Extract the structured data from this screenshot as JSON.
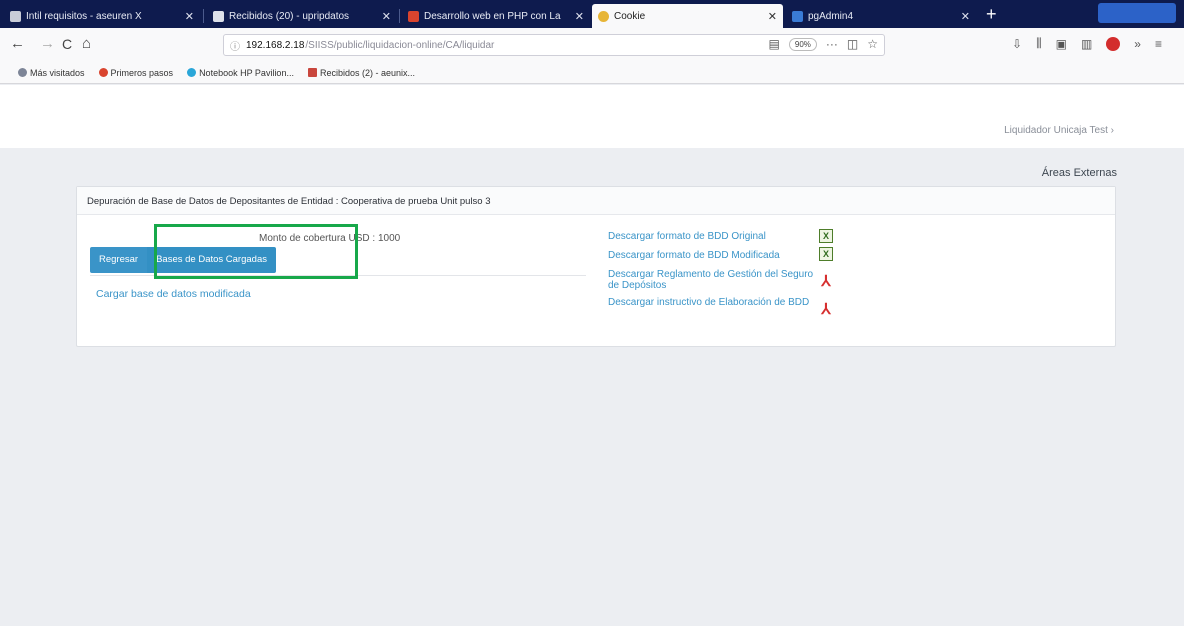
{
  "browser": {
    "tabs": [
      {
        "title": "Intil requisitos - aseuren X",
        "close": "✕",
        "favicon_color": "#c8ccd8"
      },
      {
        "title": "Recibidos (20) - upripdatos",
        "close": "✕",
        "favicon_color": "#dde1ea"
      },
      {
        "title": "Desarrollo web en PHP con La",
        "close": "✕",
        "favicon_color": "#d9442e"
      },
      {
        "title": "Cookie",
        "close": "✕",
        "favicon_color": "#e7b537"
      },
      {
        "title": "pgAdmin4",
        "close": "✕",
        "favicon_color": "#3a7bd5"
      }
    ],
    "new_tab_symbol": "+",
    "nav": {
      "back": "←",
      "forward": "→",
      "reload": "C",
      "home": "⌂"
    },
    "url": {
      "host": "192.168.2.18",
      "path": "/SIISS/public/liquidacion-online/CA/liquidar",
      "zoom": "90%",
      "more": "···"
    },
    "bookmarks": [
      {
        "label": "Más visitados",
        "color": "#7d8597"
      },
      {
        "label": "Primeros pasos",
        "color": "#d9442e"
      },
      {
        "label": "Notebook HP Pavilion...",
        "color": "#2aa6d8"
      },
      {
        "label": "Recibidos (2) - aeunix...",
        "color": "#c9463d"
      }
    ]
  },
  "header": {
    "user": "Liquidador Unicaja Test ›"
  },
  "menu": {
    "label": "Áreas Externas"
  },
  "panel": {
    "title": "Depuración de Base de Datos de Depositantes de Entidad : Cooperativa de prueba Unit pulso 3",
    "amount_text": "Monto de cobertura USD : 1000",
    "buttons": {
      "back": "Regresar",
      "loaded": "Bases de Datos Cargadas"
    },
    "upload_link": "Cargar base de datos modificada",
    "downloads": [
      {
        "label": "Descargar formato de BDD Original",
        "icon": "xls-icon",
        "glyph": "X"
      },
      {
        "label": "Descargar formato de BDD Modificada",
        "icon": "xls-icon",
        "glyph": "X"
      },
      {
        "label": "Descargar Reglamento de Gestión del Seguro de Depósitos",
        "icon": "pdf-icon",
        "glyph": "⅄"
      },
      {
        "label": "Descargar instructivo de Elaboración de BDD",
        "icon": "pdf-icon",
        "glyph": "⅄"
      }
    ]
  },
  "colors": {
    "accent": "#3a94c8",
    "highlight": "#17a84a",
    "tabbar": "#0e1b4e"
  }
}
